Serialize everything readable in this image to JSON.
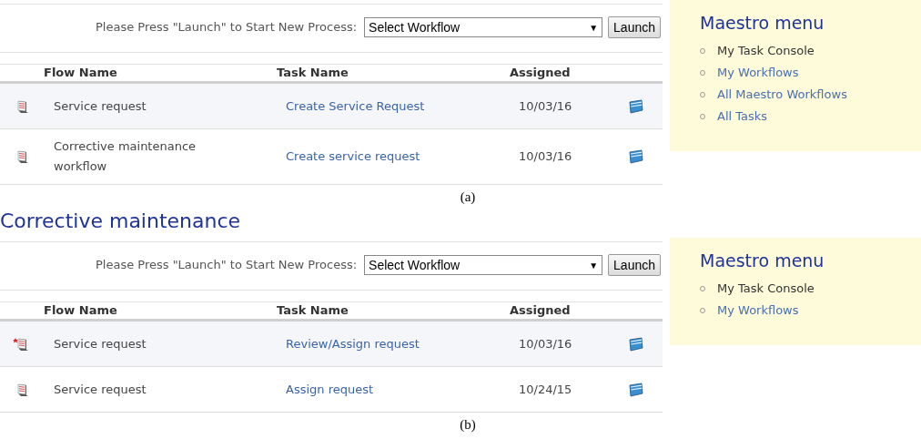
{
  "panels": [
    {
      "launch": {
        "prompt": "Please Press \"Launch\" to Start New Process:",
        "select": "Select Workflow",
        "arrow": "▼",
        "button": "Launch"
      },
      "columns": [
        "Flow Name",
        "Task Name",
        "Assigned"
      ],
      "rows": [
        {
          "flow": "Service request",
          "task": "Create Service Request",
          "assigned": "10/03/16",
          "new": false
        },
        {
          "flow": "Corrective maintenance workflow",
          "task": "Create service request",
          "assigned": "10/03/16",
          "new": false
        }
      ],
      "menu": {
        "title": "Maestro menu",
        "items": [
          {
            "label": "My Task Console",
            "selected": true
          },
          {
            "label": "My Workflows",
            "selected": false
          },
          {
            "label": "All Maestro Workflows",
            "selected": false
          },
          {
            "label": "All Tasks",
            "selected": false
          }
        ]
      },
      "caption": "(a)"
    },
    {
      "heading": "Corrective maintenance",
      "launch": {
        "prompt": "Please Press \"Launch\" to Start New Process:",
        "select": "Select Workflow",
        "arrow": "▼",
        "button": "Launch"
      },
      "columns": [
        "Flow Name",
        "Task Name",
        "Assigned"
      ],
      "rows": [
        {
          "flow": "Service request",
          "task": "Review/Assign request",
          "assigned": "10/03/16",
          "new": true
        },
        {
          "flow": "Service request",
          "task": "Assign request",
          "assigned": "10/24/15",
          "new": false
        }
      ],
      "menu": {
        "title": "Maestro menu",
        "items": [
          {
            "label": "My Task Console",
            "selected": true
          },
          {
            "label": "My Workflows",
            "selected": false
          }
        ]
      },
      "caption": "(b)"
    }
  ]
}
